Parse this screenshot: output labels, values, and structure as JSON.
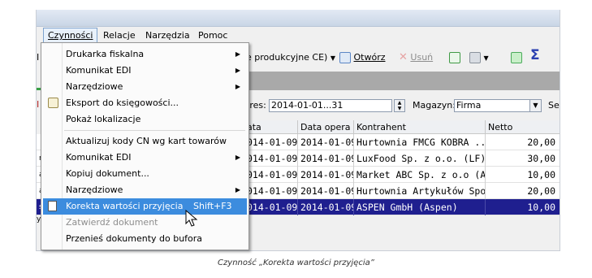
{
  "menubar": {
    "items": [
      {
        "label": "Czynności"
      },
      {
        "label": "Relacje"
      },
      {
        "label": "Narzędzia"
      },
      {
        "label": "Pomoc"
      }
    ]
  },
  "toolbar": {
    "combo_text": "e produkcyjne CE)",
    "open_label": "Otwórz",
    "delete_label": "Usuń"
  },
  "filter": {
    "period_label": "kres:",
    "period_value": "2014-01-01...31",
    "warehouse_label": "Magazyn:",
    "warehouse_value": "Firma",
    "extra_label": "Ser"
  },
  "left_glyphs": [
    "I",
    "I",
    "ra",
    "a",
    "a",
    "s",
    "y"
  ],
  "table": {
    "columns": [
      "ata",
      "Data opera",
      "Kontrahent",
      "Netto"
    ],
    "rows": [
      {
        "date": "014-01-09",
        "op_date": "2014-01-09",
        "contractor": "Hurtownia FMCG KOBRA  ...",
        "net": "20,00"
      },
      {
        "date": "014-01-09",
        "op_date": "2014-01-09",
        "contractor": "LuxFood Sp. z o.o. (LF)",
        "net": "30,00"
      },
      {
        "date": "014-01-09",
        "op_date": "2014-01-09",
        "contractor": "Market ABC Sp. z o.o (Abc)",
        "net": "10,00"
      },
      {
        "date": "014-01-09",
        "op_date": "2014-01-09",
        "contractor": "Hurtownia Artykułów Spo...",
        "net": "20,00"
      },
      {
        "date": "014-01-09",
        "op_date": "2014-01-09",
        "contractor": "ASPEN GmbH (Aspen)",
        "net": "10,00"
      }
    ]
  },
  "dropdown": {
    "items": [
      {
        "label": "Drukarka fiskalna"
      },
      {
        "label": "Komunikat EDI"
      },
      {
        "label": "Narzędziowe"
      },
      {
        "label": "Eksport do księgowości..."
      },
      {
        "label": "Pokaż lokalizacje"
      },
      {
        "label": "Aktualizuj kody CN wg kart towarów"
      },
      {
        "label": "Komunikat EDI"
      },
      {
        "label": "Kopiuj dokument..."
      },
      {
        "label": "Narzędziowe"
      },
      {
        "label": "Korekta wartości przyjęcia",
        "shortcut": "Shift+F3"
      },
      {
        "label": "Zatwierdź dokument"
      },
      {
        "label": "Przenieś dokumenty do bufora"
      }
    ]
  },
  "caption": "Czynność „Korekta wartości przyjęcia”",
  "colors": {
    "selected_row": "#1f1f8f",
    "menu_highlight": "#3c8cde",
    "green_marker": "#3aa046"
  }
}
